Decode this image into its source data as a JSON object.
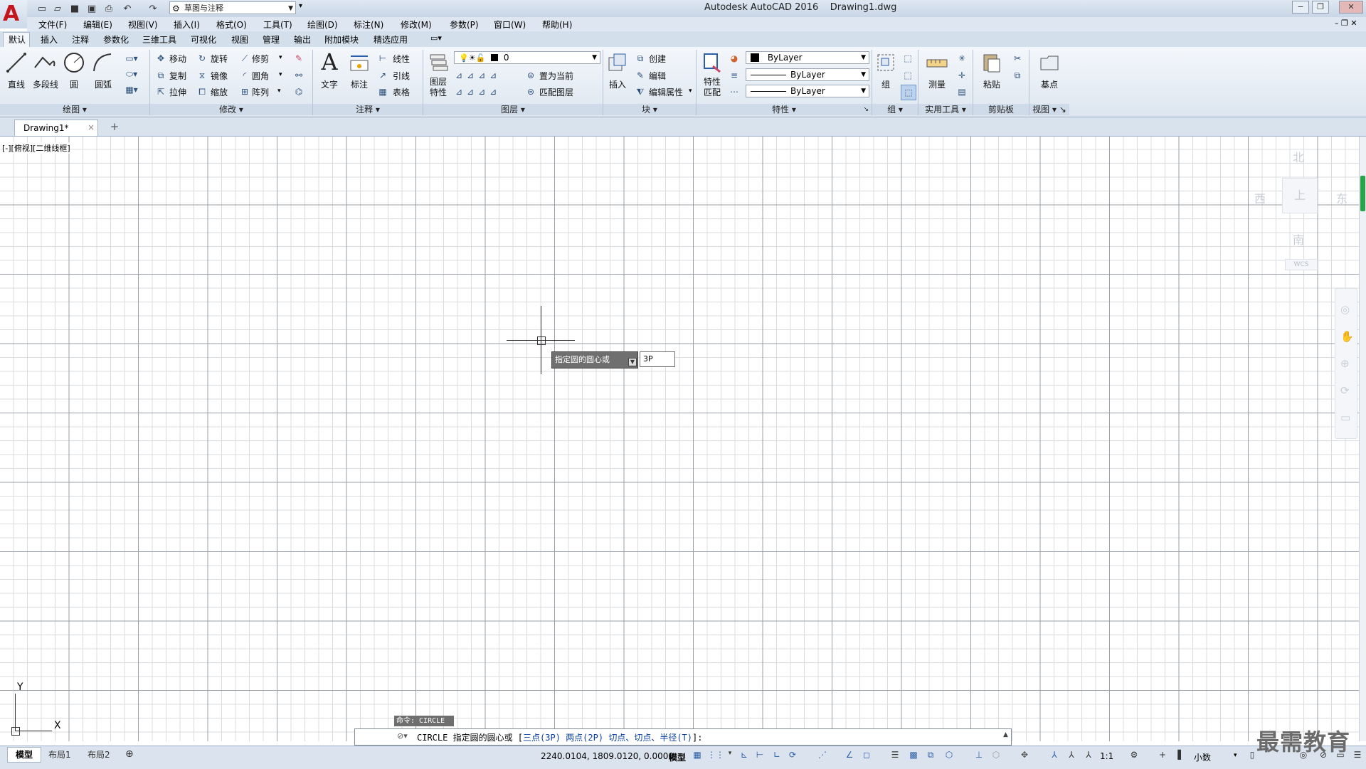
{
  "app": {
    "title": "Autodesk AutoCAD 2016    Drawing1.dwg",
    "logo_letter": "A",
    "workspace": "草图与注释"
  },
  "menu": [
    "文件(F)",
    "编辑(E)",
    "视图(V)",
    "插入(I)",
    "格式(O)",
    "工具(T)",
    "绘图(D)",
    "标注(N)",
    "修改(M)",
    "参数(P)",
    "窗口(W)",
    "帮助(H)"
  ],
  "ribbon_tabs": [
    "默认",
    "插入",
    "注释",
    "参数化",
    "三维工具",
    "可视化",
    "视图",
    "管理",
    "输出",
    "附加模块",
    "精选应用"
  ],
  "ribbon": {
    "draw": {
      "title": "绘图",
      "line": "直线",
      "polyline": "多段线",
      "circle": "圆",
      "arc": "圆弧"
    },
    "modify": {
      "title": "修改",
      "move": "移动",
      "rotate": "旋转",
      "trim": "修剪",
      "copy": "复制",
      "mirror": "镜像",
      "fillet": "圆角",
      "stretch": "拉伸",
      "scale": "缩放",
      "array": "阵列"
    },
    "annotation": {
      "title": "注释",
      "text": "文字",
      "dimension": "标注",
      "linear": "线性",
      "leader": "引线",
      "table": "表格"
    },
    "layers": {
      "title": "图层",
      "properties": "图层\n特性",
      "current_layer": "0",
      "set_current": "置为当前",
      "match_layer": "匹配图层"
    },
    "block": {
      "title": "块",
      "insert": "插入",
      "create": "创建",
      "edit": "编辑",
      "edit_attr": "编辑属性"
    },
    "properties": {
      "title": "特性",
      "match": "特性\n匹配",
      "color": "ByLayer",
      "linetype": "ByLayer",
      "lineweight": "ByLayer"
    },
    "groups": {
      "title": "组",
      "group": "组"
    },
    "utilities": {
      "title": "实用工具",
      "measure": "测量"
    },
    "clipboard": {
      "title": "剪贴板",
      "paste": "粘贴"
    },
    "view": {
      "title": "视图",
      "base": "基点"
    }
  },
  "file_tab": {
    "name": "Drawing1*",
    "close": "×",
    "add": "+"
  },
  "viewport_label": "[-][俯视][二维线框]",
  "viewcube": {
    "north": "北",
    "south": "南",
    "east": "东",
    "west": "西",
    "top": "上",
    "wcs": "WCS"
  },
  "ucs": {
    "x": "X",
    "y": "Y"
  },
  "dynamic_prompt": {
    "text": "指定圆的圆心或",
    "input": "3P"
  },
  "command": {
    "history": "命令: CIRCLE",
    "prefix": "CIRCLE 指定圆的圆心或 [",
    "opt1": "三点(3P)",
    "opt2": "两点(2P)",
    "opt3": "切点、切点、半径(T)",
    "suffix": "]:"
  },
  "layout_tabs": [
    "模型",
    "布局1",
    "布局2"
  ],
  "status": {
    "coords": "2240.0104, 1809.0120, 0.0000",
    "model": "模型",
    "scale": "1:1",
    "units": "小数"
  },
  "watermark": "最需教育",
  "colors": {
    "accent": "#c4161c",
    "ribbon_bg": "#dde6f0",
    "grid_major": "#9aa0a6",
    "grid_minor": "#d9dcdf"
  }
}
